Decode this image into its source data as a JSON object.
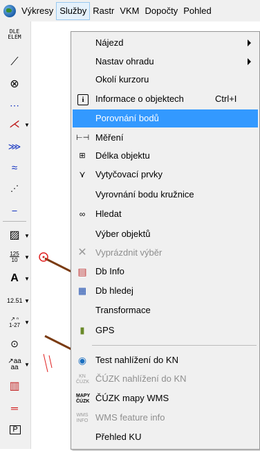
{
  "menubar": {
    "items": [
      "Výkresy",
      "Služby",
      "Rastr",
      "VKM",
      "Dopočty",
      "Pohled"
    ]
  },
  "toolbar": {
    "items": [
      {
        "icon": "DLE\nELEM",
        "name": "dle-elem-icon"
      },
      {
        "icon": "⟋",
        "name": "line-icon"
      },
      {
        "icon": "⊙",
        "name": "circle-icon"
      },
      {
        "icon": "⋯",
        "name": "dotted-line-icon"
      },
      {
        "icon": "⋌",
        "name": "angle-icon"
      },
      {
        "icon": "≫",
        "name": "offset-icon"
      },
      {
        "icon": "≈",
        "name": "curve-icon"
      },
      {
        "icon": "⋰",
        "name": "points-icon"
      },
      {
        "icon": "⎯",
        "name": "dashed-line-icon"
      },
      {
        "icon": "▨",
        "name": "hatch-icon"
      },
      {
        "icon": "125/10",
        "name": "fraction-text-icon"
      },
      {
        "icon": "A",
        "name": "text-icon"
      },
      {
        "icon": "12.51",
        "name": "dimension-icon"
      },
      {
        "icon": "↑1-27",
        "name": "numbering-icon"
      },
      {
        "icon": "⊙",
        "name": "point-symbol-icon"
      },
      {
        "icon": "aa",
        "name": "text-style-icon"
      },
      {
        "icon": "▥",
        "name": "red-hatch-icon"
      },
      {
        "icon": "═",
        "name": "red-line-icon"
      },
      {
        "icon": "P",
        "name": "parcel-icon"
      }
    ]
  },
  "menu": {
    "items": [
      {
        "label": "Nájezd",
        "submenu": true
      },
      {
        "label": "Nastav ohradu",
        "submenu": true
      },
      {
        "label": "Okolí kurzoru"
      },
      {
        "label": "Informace o objektech",
        "shortcut": "Ctrl+I",
        "icon": "i"
      },
      {
        "label": "Porovnání bodů",
        "highlighted": true
      },
      {
        "label": "Měření",
        "icon": "ruler"
      },
      {
        "label": "Délka objektu",
        "icon": "length"
      },
      {
        "label": "Vytyčovací prvky",
        "icon": "stakeout"
      },
      {
        "label": "Vyrovnání bodu kružnice"
      },
      {
        "label": "Hledat",
        "icon": "binoculars"
      },
      {
        "label": "Výber objektů"
      },
      {
        "label": "Vyprázdnit výběr",
        "disabled": true,
        "icon": "x"
      },
      {
        "label": "Db Info",
        "icon": "db"
      },
      {
        "label": "Db hledej",
        "icon": "db-search"
      },
      {
        "label": "Transformace"
      },
      {
        "label": "GPS",
        "icon": "gps"
      },
      {
        "label": "Test nahlížení do KN",
        "icon": "globe-search"
      },
      {
        "label": "ČÚZK nahlížení do KN",
        "disabled": true,
        "icon": "KN\nČÚZK"
      },
      {
        "label": "ČÚZK mapy WMS",
        "icon": "MAPY\nČÚZK"
      },
      {
        "label": "WMS feature info",
        "disabled": true,
        "icon": "WMS\nINFO"
      },
      {
        "label": "Přehled KU"
      }
    ]
  },
  "colors": {
    "highlight": "#3399ff",
    "menu_bg": "#f0f0f0",
    "disabled_text": "#8e8e8e",
    "canvas_line_brown": "#7a3b12",
    "canvas_red": "#e02020"
  }
}
